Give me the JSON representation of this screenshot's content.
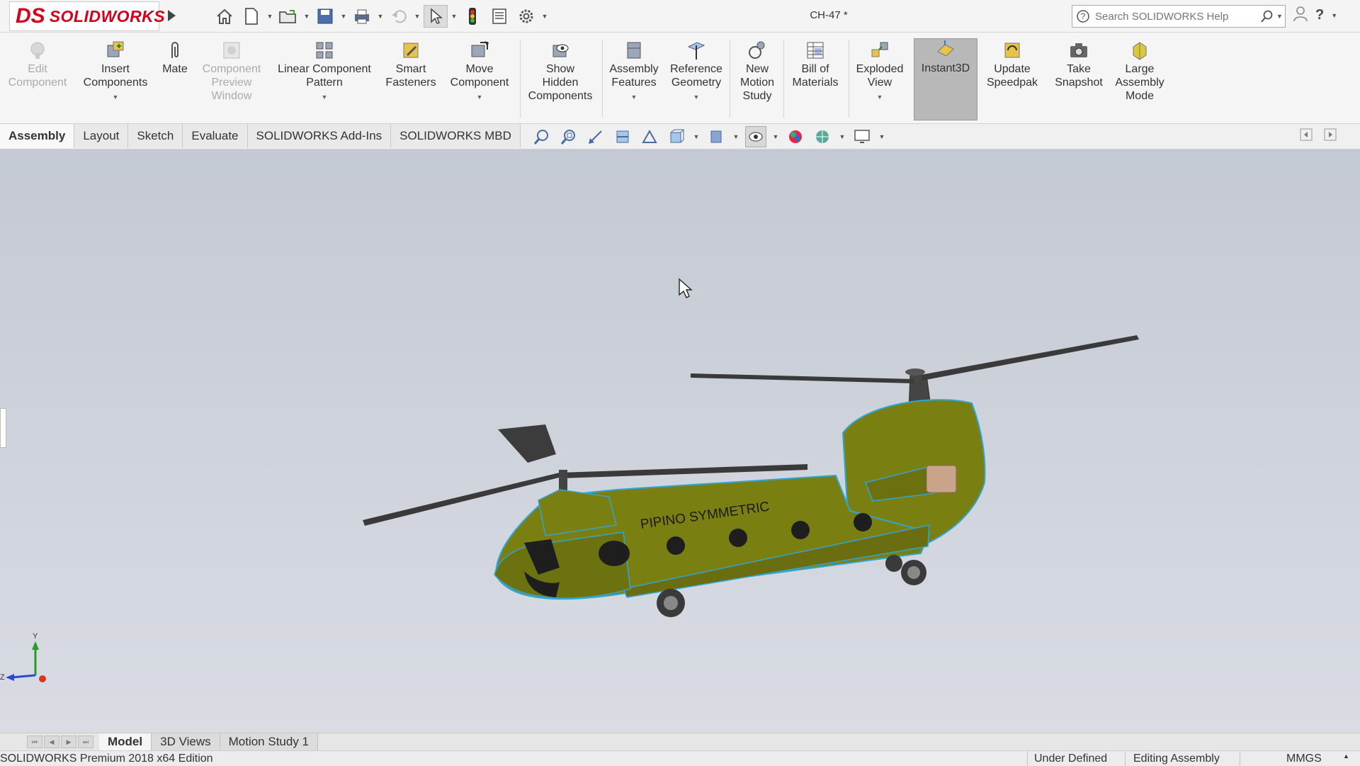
{
  "app": {
    "brand_ds": "DS",
    "brand_name": "SOLIDWORKS"
  },
  "document": {
    "title": "CH-47 *"
  },
  "search": {
    "placeholder": "Search SOLIDWORKS Help"
  },
  "ribbon": {
    "commands": [
      {
        "label": "Edit\nComponent",
        "enabled": false
      },
      {
        "label": "Insert\nComponents",
        "enabled": true
      },
      {
        "label": "Mate",
        "enabled": true
      },
      {
        "label": "Component\nPreview\nWindow",
        "enabled": false
      },
      {
        "label": "Linear Component\nPattern",
        "enabled": true
      },
      {
        "label": "Smart\nFasteners",
        "enabled": true
      },
      {
        "label": "Move\nComponent",
        "enabled": true
      },
      {
        "label": "Show\nHidden\nComponents",
        "enabled": true
      },
      {
        "label": "Assembly\nFeatures",
        "enabled": true
      },
      {
        "label": "Reference\nGeometry",
        "enabled": true
      },
      {
        "label": "New\nMotion\nStudy",
        "enabled": true
      },
      {
        "label": "Bill of\nMaterials",
        "enabled": true
      },
      {
        "label": "Exploded\nView",
        "enabled": true
      },
      {
        "label": "Instant3D",
        "enabled": true,
        "active": true
      },
      {
        "label": "Update\nSpeedpak",
        "enabled": true
      },
      {
        "label": "Take\nSnapshot",
        "enabled": true
      },
      {
        "label": "Large\nAssembly\nMode",
        "enabled": true
      }
    ]
  },
  "tabs": [
    "Assembly",
    "Layout",
    "Sketch",
    "Evaluate",
    "SOLIDWORKS Add-Ins",
    "SOLIDWORKS MBD"
  ],
  "active_tab": "Assembly",
  "model": {
    "fuselage_text": "PIPINO SYMMETRIC",
    "body_color": "#7a7f12",
    "edge_color": "#2fa6d6"
  },
  "triad": {
    "y": "Y",
    "z": "Z"
  },
  "bottom_tabs": [
    "Model",
    "3D Views",
    "Motion Study 1"
  ],
  "status": {
    "edition": "SOLIDWORKS Premium 2018 x64 Edition",
    "definition": "Under Defined",
    "mode": "Editing Assembly",
    "units": "MMGS"
  }
}
